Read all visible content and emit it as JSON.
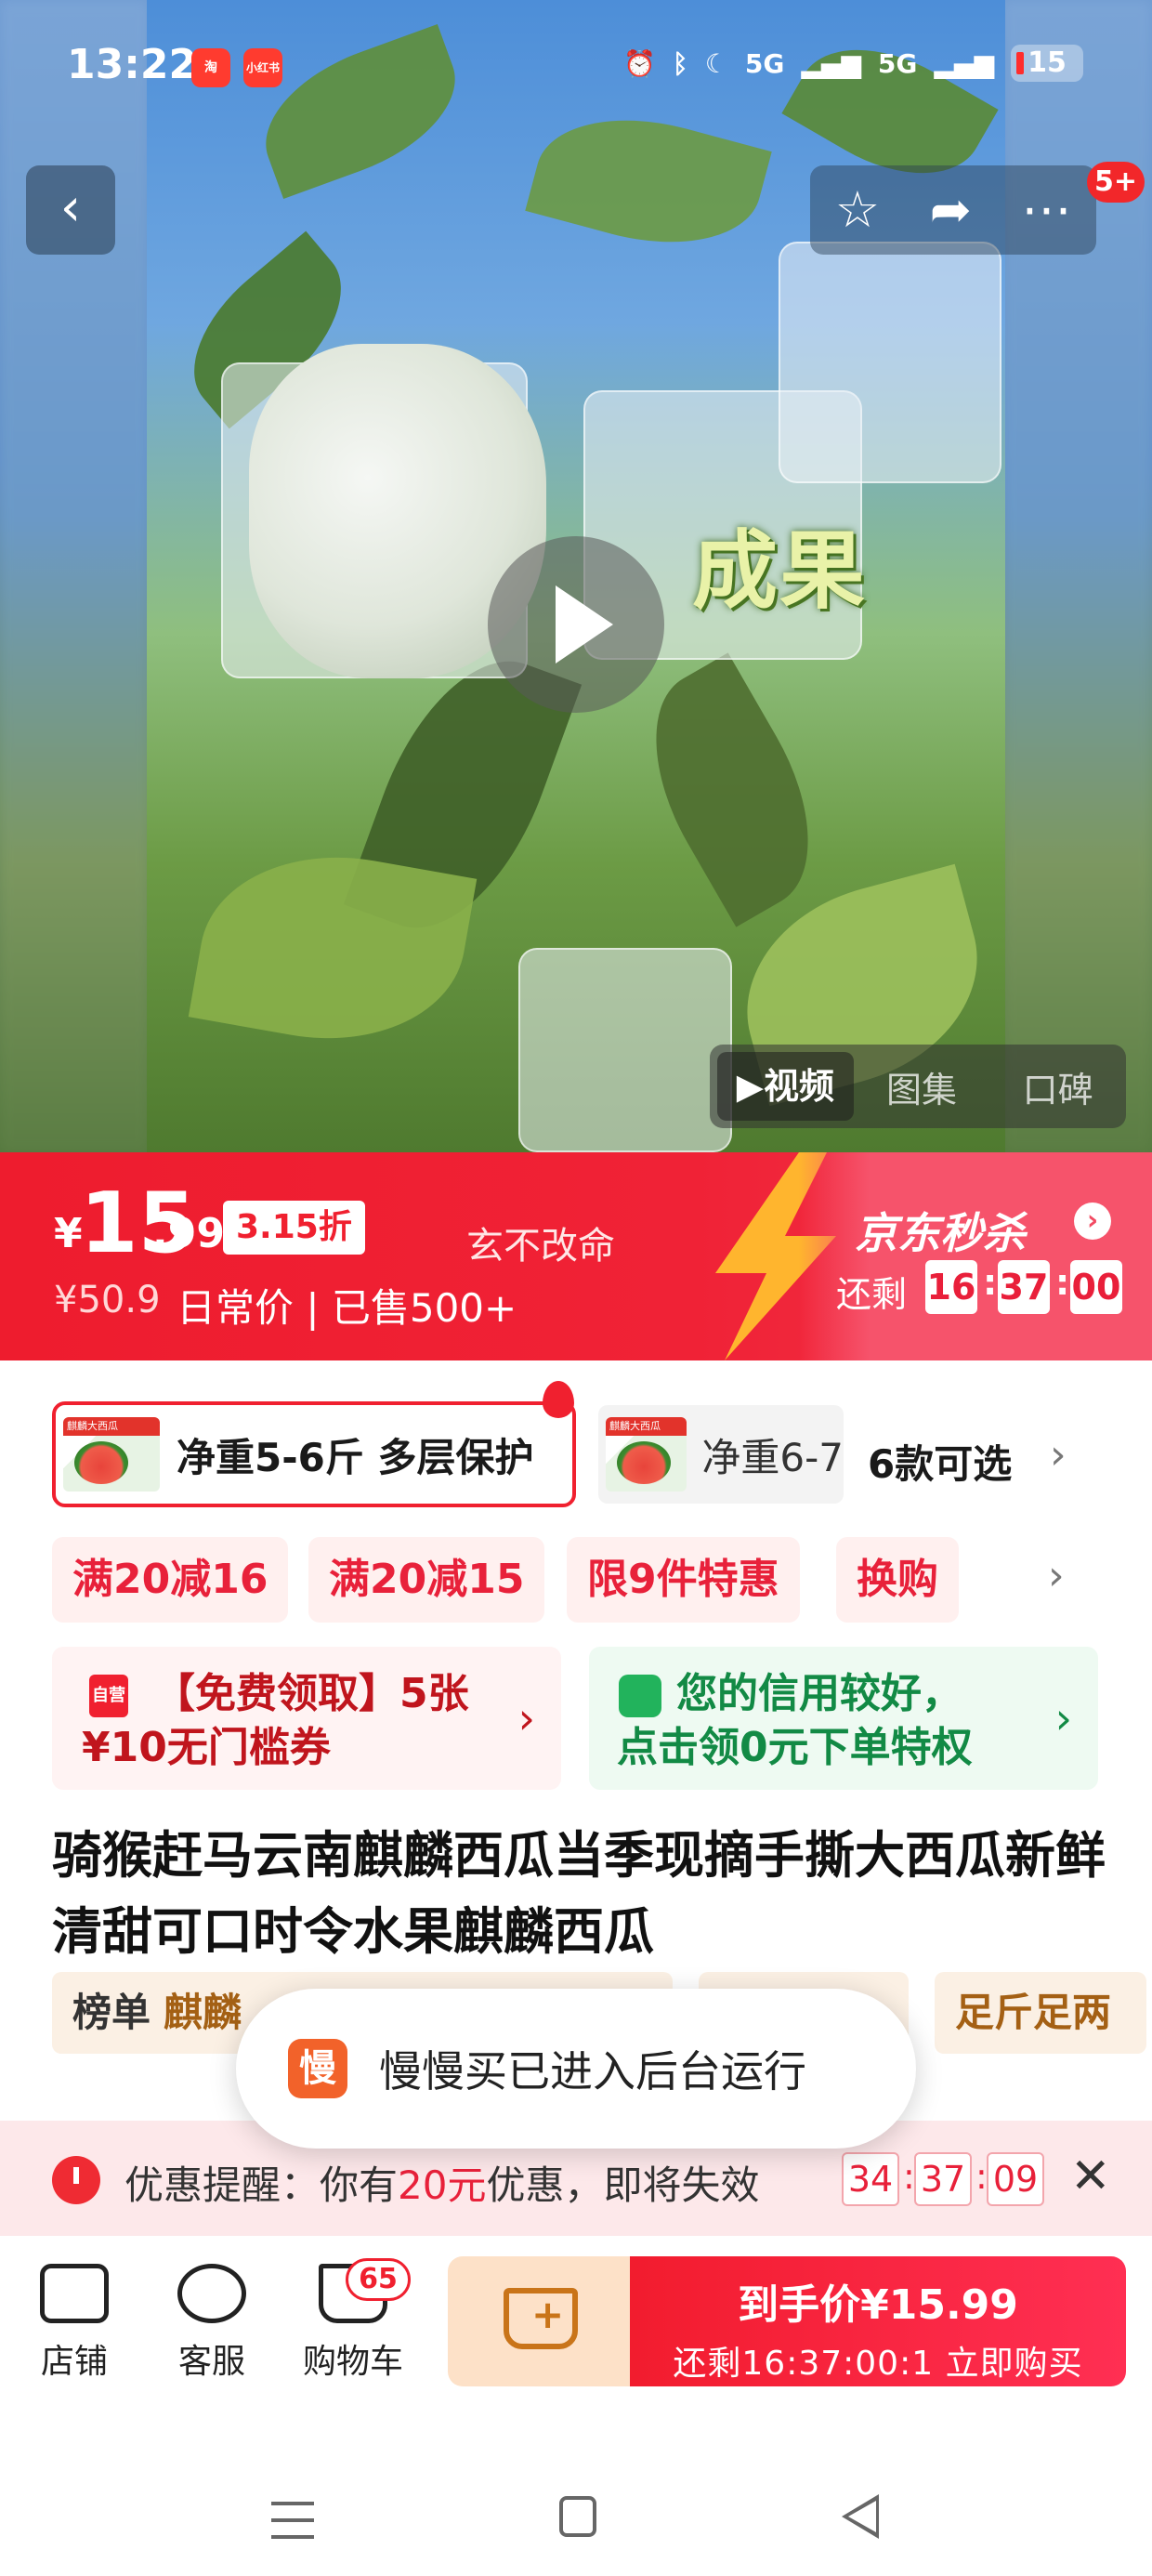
{
  "status_bar": {
    "time": "13:22",
    "app_badges": [
      "淘",
      "小红书"
    ],
    "network_labels": [
      "5G",
      "5G"
    ],
    "battery_level": "15"
  },
  "nav": {
    "back_icon": "chevron-left-icon",
    "favorite_icon": "star-icon",
    "share_icon": "share-icon",
    "more_icon": "more-icon",
    "more_badge": "5+"
  },
  "media": {
    "overlay_caption": "成果",
    "tabs": [
      {
        "label": "▶视频",
        "active": true
      },
      {
        "label": "图集",
        "active": false
      },
      {
        "label": "口碑",
        "active": false
      }
    ]
  },
  "price": {
    "currency": "¥",
    "price_integer": "15",
    "price_decimal": ".99",
    "discount": "3.15折",
    "seller_name": "玄不改命",
    "original_price": "¥50.9",
    "sold_info": "日常价 | 已售500+",
    "accent_color": "#ee1c2e"
  },
  "flash_sale": {
    "title": "京东秒杀",
    "remaining_label": "还剩",
    "hours": "16",
    "minutes": "37",
    "seconds": "00"
  },
  "variants": {
    "selected_label": "净重5-6斤 多层保护",
    "other_label": "净重6-7",
    "thumb_header": "麒麟大西瓜",
    "count_label": "6款可选"
  },
  "promo_chips": [
    "满20减16",
    "满20减15",
    "限9件特惠",
    "换购"
  ],
  "coupons": {
    "red": {
      "icon_text": "自营",
      "line1": "【免费领取】5张",
      "line2": "¥10无门槛券"
    },
    "green": {
      "line1": "您的信用较好，",
      "line2": "点击领0元下单特权"
    }
  },
  "product_title": "骑猴赶马云南麒麟西瓜当季现摘手撕大西瓜新鲜清甜可口时令水果麒麟西瓜",
  "tags": [
    {
      "key": "榜单",
      "value": "麒麟"
    },
    {
      "key": "足斤足两",
      "value": ""
    }
  ],
  "toast": {
    "icon_text": "慢",
    "message": "慢慢买已进入后台运行"
  },
  "reminder": {
    "prefix": "优惠提醒：你有",
    "amount": "20元",
    "suffix": "优惠，即将失效",
    "hours": "34",
    "minutes": "37",
    "seconds": "09"
  },
  "actions": {
    "shop_label": "店铺",
    "service_label": "客服",
    "cart_label": "购物车",
    "cart_count": "65",
    "buy_line1": "到手价¥15.99",
    "buy_line2": "还剩16:37:00:1 立即购买"
  }
}
